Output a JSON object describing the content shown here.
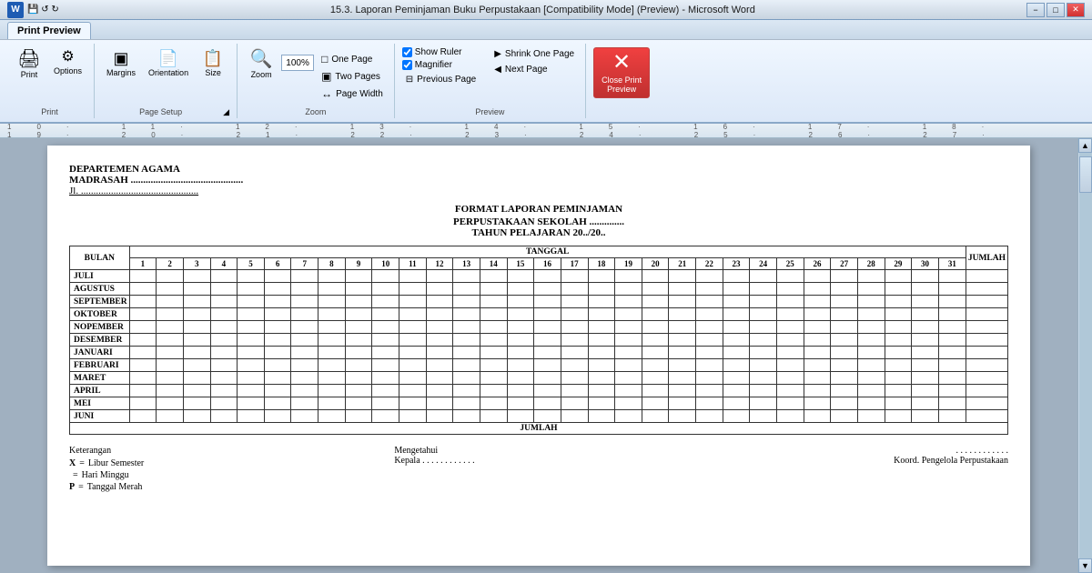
{
  "titlebar": {
    "title": "15.3. Laporan Peminjaman Buku Perpustakaan [Compatibility Mode] (Preview) - Microsoft Word",
    "minimize": "−",
    "maximize": "□",
    "close": "✕"
  },
  "ribbon_tabs": [
    {
      "label": "Print Preview",
      "active": true
    }
  ],
  "ribbon": {
    "groups": [
      {
        "name": "print-group",
        "label": "Print",
        "buttons": [
          {
            "name": "print-btn",
            "icon": "🖨",
            "label": "Print"
          },
          {
            "name": "options-btn",
            "icon": "⚙",
            "label": "Options"
          }
        ]
      },
      {
        "name": "page-setup-group",
        "label": "Page Setup",
        "buttons": [
          {
            "name": "margins-btn",
            "icon": "▣",
            "label": "Margins"
          },
          {
            "name": "orientation-btn",
            "icon": "📄",
            "label": "Orientation"
          },
          {
            "name": "size-btn",
            "icon": "📋",
            "label": "Size"
          }
        ],
        "expand_icon": "◢"
      },
      {
        "name": "zoom-group",
        "label": "Zoom",
        "items": [
          {
            "name": "zoom-btn",
            "icon": "🔍",
            "label": "Zoom"
          },
          {
            "name": "zoom-value",
            "value": "100%"
          }
        ],
        "small_buttons": [
          {
            "name": "one-page-btn",
            "icon": "□",
            "label": "One Page"
          },
          {
            "name": "two-pages-btn",
            "icon": "□□",
            "label": "Two Pages"
          },
          {
            "name": "page-width-btn",
            "icon": "↔",
            "label": "Page Width"
          }
        ]
      },
      {
        "name": "preview-group",
        "label": "Preview",
        "checkboxes": [
          {
            "name": "show-ruler-check",
            "label": "Show Ruler",
            "checked": true
          },
          {
            "name": "magnifier-check",
            "label": "Magnifier",
            "checked": true
          }
        ],
        "buttons": [
          {
            "name": "shrink-one-page-btn",
            "icon": "⊟",
            "label": "Shrink One Page"
          },
          {
            "name": "next-page-btn",
            "icon": "▶",
            "label": "Next Page"
          },
          {
            "name": "prev-page-btn",
            "icon": "◀",
            "label": "Previous Page"
          }
        ]
      },
      {
        "name": "close-group",
        "label": "",
        "close_btn": {
          "name": "close-preview-btn",
          "label": "Close Print\nPreview",
          "icon": "✕"
        }
      }
    ]
  },
  "document": {
    "header_line1": "DEPARTEMEN AGAMA",
    "header_line2": "MADRASAH .............................................",
    "header_line3": "Jl. ...............................................",
    "title_line1": "FORMAT LAPORAN PEMINJAMAN",
    "title_line2": "PERPUSTAKAAN SEKOLAH ..............",
    "title_line3": "TAHUN PELAJARAN 20../20..",
    "table": {
      "col_bulan": "BULAN",
      "col_tanggal": "TANGGAL",
      "col_jumlah": "JUMLAH",
      "dates": [
        "1",
        "2",
        "3",
        "4",
        "5",
        "6",
        "7",
        "8",
        "9",
        "10",
        "11",
        "12",
        "13",
        "14",
        "15",
        "16",
        "17",
        "18",
        "19",
        "20",
        "21",
        "22",
        "23",
        "24",
        "25",
        "26",
        "27",
        "28",
        "29",
        "30",
        "31"
      ],
      "months": [
        "JULI",
        "AGUSTUS",
        "SEPTEMBER",
        "OKTOBER",
        "NOPEMBER",
        "DESEMBER",
        "JANUARI",
        "FEBRUARI",
        "MARET",
        "APRIL",
        "MEI",
        "JUNI"
      ],
      "jumlah_row": "JUMLAH"
    },
    "footer": {
      "keterangan_title": "Keterangan",
      "items": [
        {
          "symbol": "X",
          "eq": "=",
          "meaning": "Libur Semester"
        },
        {
          "symbol": "",
          "eq": "=",
          "meaning": "Hari Minggu"
        },
        {
          "symbol": "P",
          "eq": "=",
          "meaning": "Tanggal Merah"
        }
      ],
      "mengetahui_title": "Mengetahui",
      "mengetahui_label": "Kepala . . . . . . . . . . . .",
      "koordinator_dots": ". . . . . . . . . . . .",
      "koordinator_label": "Koord. Pengelola Perpustakaan"
    }
  }
}
